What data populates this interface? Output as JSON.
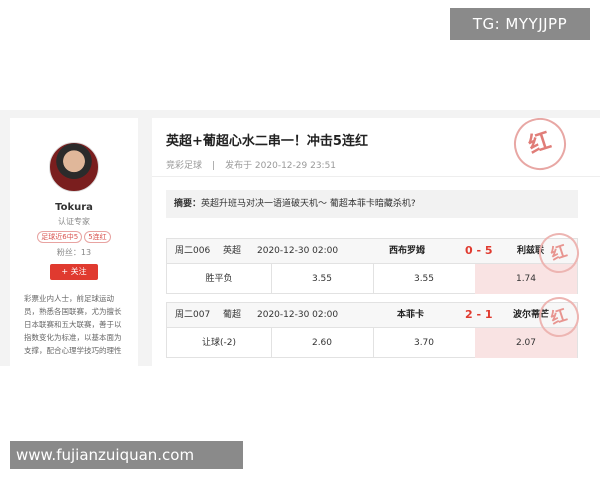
{
  "watermarks": {
    "top": "TG: MYYJJPP",
    "bottom": "www.fujianzuiquan.com"
  },
  "profile": {
    "name": "Tokura",
    "title": "认证专家",
    "tags": [
      "足球近6中5",
      "5连红"
    ],
    "fans": "粉丝：13",
    "follow_label": "+ 关注",
    "bio": [
      "彩票业内人士，前足球运动",
      "员，熟悉各国联赛，尤为擅长",
      "日本联赛和五大联赛，善于以",
      "指数变化为标准，以基本面为",
      "支撑，配合心理学技巧的理性"
    ]
  },
  "article": {
    "title": "英超+葡超心水二串一！冲击5连红",
    "category": "竞彩足球",
    "published": "发布于 2020-12-29 23:51",
    "stamp": "红",
    "summary_label": "摘要：",
    "summary_text": "英超升班马对决一语道破天机～ 葡超本菲卡暗藏杀机?"
  },
  "matches": [
    {
      "code": "周二006",
      "league": "英超",
      "time": "2020-12-30 02:00",
      "home": "西布罗姆",
      "score": "0 - 5",
      "away": "利兹联",
      "odds_label": "胜平负",
      "odds": [
        "3.55",
        "3.55",
        "1.74"
      ],
      "stamp": "红"
    },
    {
      "code": "周二007",
      "league": "葡超",
      "time": "2020-12-30 02:00",
      "home": "本菲卡",
      "score": "2 - 1",
      "away": "波尔蒂芒",
      "odds_label": "让球(-2)",
      "odds": [
        "2.60",
        "3.70",
        "2.07"
      ],
      "stamp": "红"
    }
  ],
  "colors": {
    "accent": "#e03a2f",
    "pick_bg": "#f9e3e3",
    "stamp": "#e07d78"
  }
}
